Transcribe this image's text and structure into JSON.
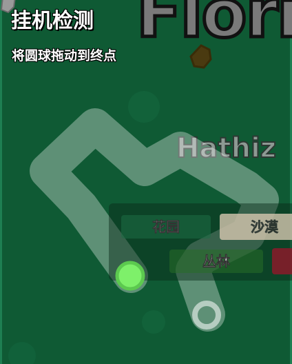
{
  "background": {
    "board_color": "#0f5a34",
    "border_color": "#1e7f52"
  },
  "logo_text": "Florr",
  "player_name": "Hathiz",
  "captcha": {
    "title": "挂机检测",
    "instruction": "将圆球拖动到终点",
    "path_color": "#ffffff",
    "ball_color": "#7ef06a",
    "ball_ring_color": "#5cc94f",
    "goal_icon": "hollow-ring-icon"
  },
  "biome_selector": {
    "buttons": [
      {
        "label": "花园",
        "color": "#1e6e46"
      },
      {
        "label": "沙漠",
        "color": "#d6c7b0"
      },
      {
        "label": "丛林",
        "color": "#286e28"
      },
      {
        "label": "",
        "color": "#8b1a2a"
      }
    ]
  }
}
